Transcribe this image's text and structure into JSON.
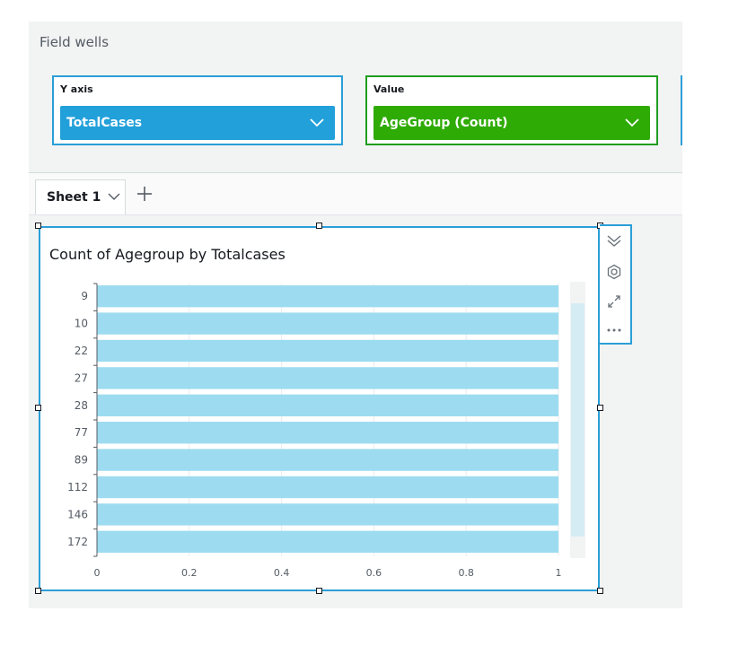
{
  "field_wells": {
    "title": "Field wells",
    "y_axis": {
      "label": "Y axis",
      "field": "TotalCases",
      "accent": "#22a0da"
    },
    "value": {
      "label": "Value",
      "field": "AgeGroup (Count)",
      "accent": "#2fab06"
    }
  },
  "sheets": {
    "tabs": [
      {
        "label": "Sheet 1"
      }
    ]
  },
  "icons": {
    "well_dropdown": "chevron-down-icon",
    "tab_menu": "chevron-down-icon",
    "add_sheet": "plus-icon",
    "collapse": "double-chevron-down-icon",
    "format": "gear-icon",
    "expand": "expand-icon",
    "more": "more-options-icon"
  },
  "visual": {
    "title": "Count of Agegroup by Totalcases",
    "border_color": "#2a9fd8"
  },
  "chart_data": {
    "type": "bar",
    "orientation": "horizontal",
    "title": "Count of Agegroup by Totalcases",
    "categories": [
      "9",
      "10",
      "22",
      "27",
      "28",
      "77",
      "89",
      "112",
      "146",
      "172"
    ],
    "values": [
      1,
      1,
      1,
      1,
      1,
      1,
      1,
      1,
      1,
      1
    ],
    "xlim": [
      0,
      1
    ],
    "xticks": [
      "0",
      "0.2",
      "0.4",
      "0.6",
      "0.8",
      "1"
    ],
    "grid": true,
    "bar_color": "#9ddcf0",
    "xlabel": "",
    "ylabel": ""
  }
}
